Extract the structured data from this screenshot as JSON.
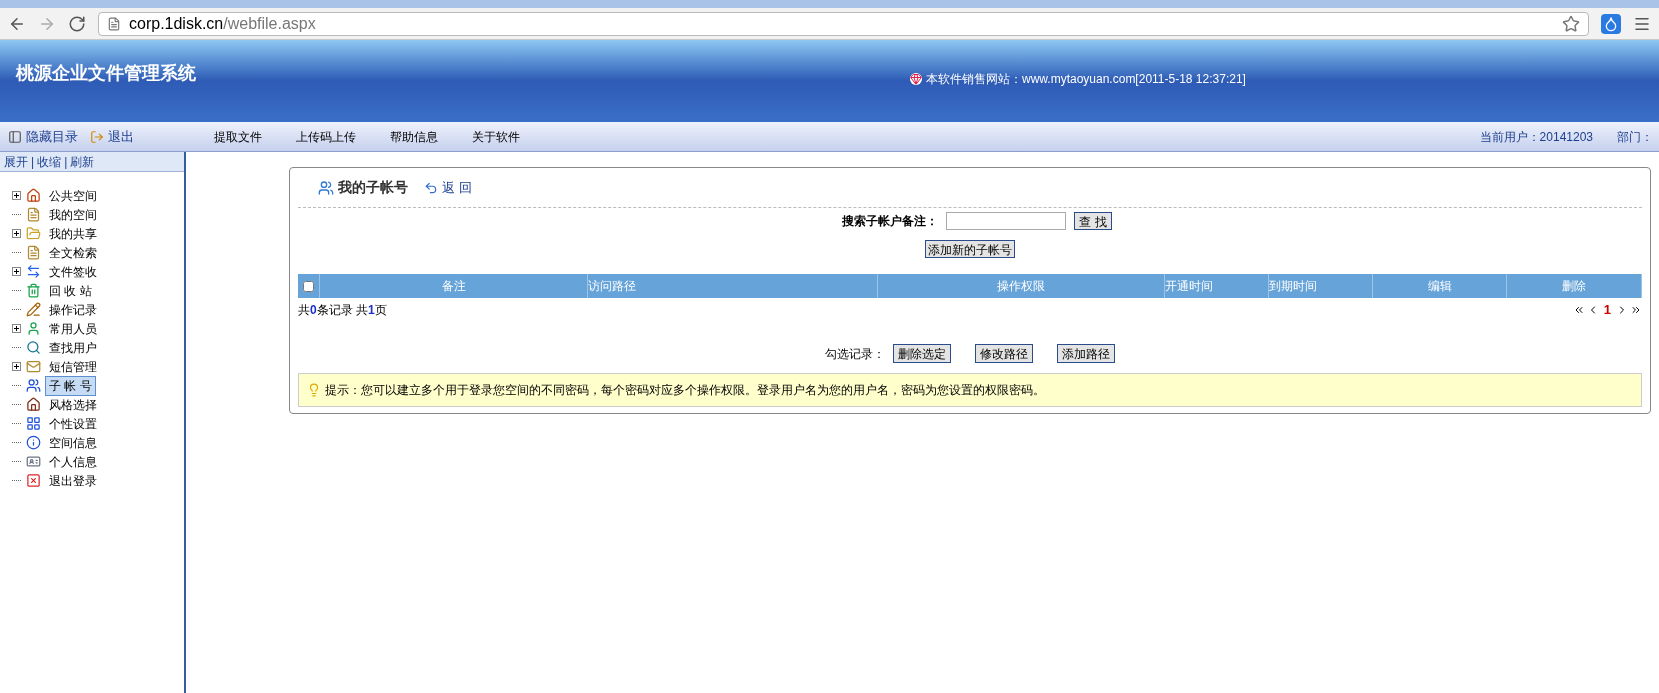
{
  "browser": {
    "url_host": "corp.1disk.cn",
    "url_path": "/webfile.aspx"
  },
  "header": {
    "title": "桃源企业文件管理系统",
    "site_text": "本软件销售网站：www.mytaoyuan.com[2011-5-18 12:37:21]"
  },
  "nav": {
    "left_links": [
      "隐藏目录",
      "退出"
    ],
    "menu": [
      "提取文件",
      "上传码上传",
      "帮助信息",
      "关于软件"
    ],
    "user": "当前用户：20141203",
    "dept": "部门："
  },
  "sidebar": {
    "actions": [
      "展开",
      "收缩",
      "刷新"
    ],
    "separator": "|",
    "tree": [
      {
        "label": "公共空间",
        "kind": "folder",
        "selected": false
      },
      {
        "label": "我的空间",
        "kind": "leaf",
        "selected": false
      },
      {
        "label": "我的共享",
        "kind": "folder",
        "selected": false
      },
      {
        "label": "全文检索",
        "kind": "leaf",
        "selected": false
      },
      {
        "label": "文件签收",
        "kind": "folder",
        "selected": false
      },
      {
        "label": "回 收 站",
        "kind": "leaf",
        "selected": false
      },
      {
        "label": "操作记录",
        "kind": "leaf",
        "selected": false
      },
      {
        "label": "常用人员",
        "kind": "folder",
        "selected": false
      },
      {
        "label": "查找用户",
        "kind": "leaf",
        "selected": false
      },
      {
        "label": "短信管理",
        "kind": "folder",
        "selected": false
      },
      {
        "label": "子 帐 号",
        "kind": "leaf",
        "selected": true
      },
      {
        "label": "风格选择",
        "kind": "leaf",
        "selected": false
      },
      {
        "label": "个性设置",
        "kind": "leaf",
        "selected": false
      },
      {
        "label": "空间信息",
        "kind": "leaf",
        "selected": false
      },
      {
        "label": "个人信息",
        "kind": "leaf",
        "selected": false
      },
      {
        "label": "退出登录",
        "kind": "leaf",
        "selected": false
      }
    ]
  },
  "panel": {
    "title": "我的子帐号",
    "back": "返 回",
    "search_label": "搜索子帐户备注：",
    "search_button": "查 找",
    "add_button": "添加新的子帐号",
    "table": {
      "select_all": false,
      "columns": [
        "备注",
        "访问路径",
        "操作权限",
        "开通时间",
        "到期时间",
        "编辑",
        "删除"
      ]
    },
    "summary": "共**0**条记录 共**1**页",
    "current_page": "1",
    "bulk_label": "勾选记录：",
    "bulk_buttons": [
      "删除选定",
      "修改路径",
      "添加路径"
    ],
    "tip": "提示：您可以建立多个用于登录您空间的不同密码，每个密码对应多个操作权限。登录用户名为您的用户名，密码为您设置的权限密码。"
  }
}
